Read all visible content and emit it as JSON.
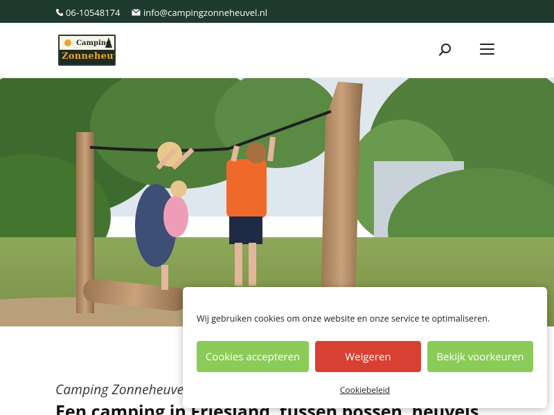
{
  "topbar": {
    "phone": "06-10548174",
    "email": "info@campingzonneheuvel.nl",
    "phone_icon": "phone-icon",
    "email_icon": "envelope-icon",
    "background": "#1f3a2e"
  },
  "header": {
    "logo": {
      "line1": "Camping",
      "line2": "Zonneheuvel"
    },
    "search_icon": "search-icon",
    "menu_icon": "hamburger-menu-icon"
  },
  "content": {
    "subtitle": "Camping Zonneheuvel",
    "headline": "Een camping in Friesland, tussen bossen, heuvels"
  },
  "cookie_banner": {
    "message": "Wij gebruiken cookies om onze website en onze service te optimaliseren.",
    "accept_label": "Cookies accepteren",
    "deny_label": "Weigeren",
    "preferences_label": "Bekijk voorkeuren",
    "policy_link": "Cookiebeleid",
    "accent_green": "#8bcc58",
    "accent_red": "#d84033"
  }
}
